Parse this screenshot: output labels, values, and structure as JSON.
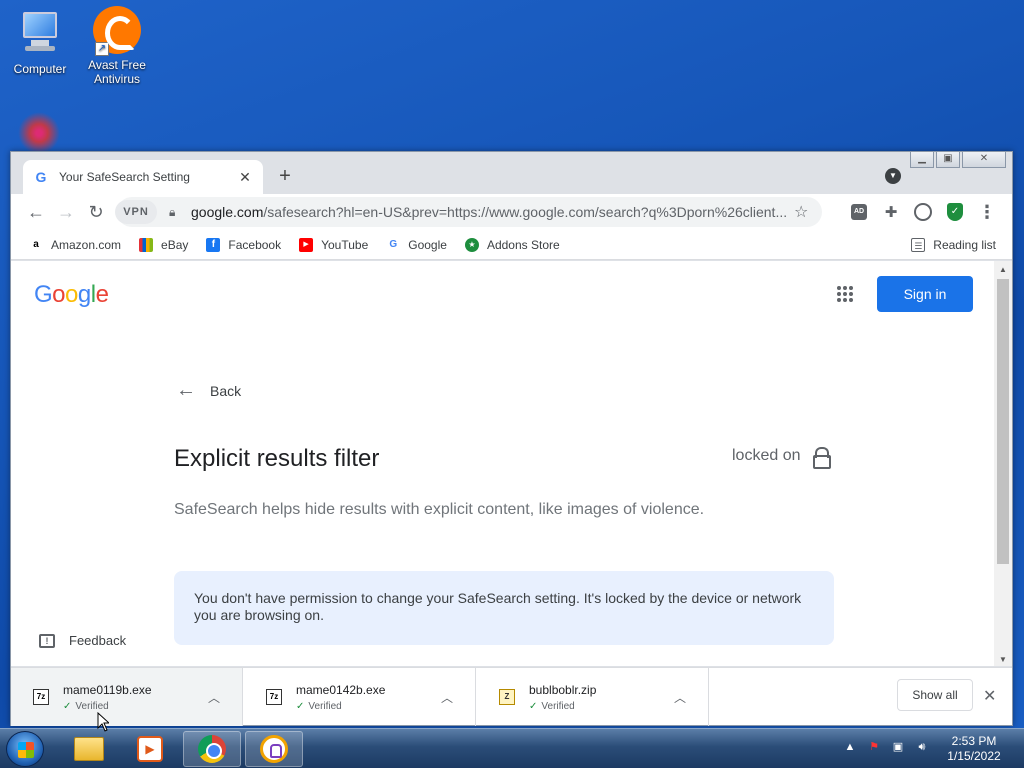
{
  "desktop": {
    "icons": [
      {
        "label": "Computer"
      },
      {
        "label_line1": "Avast Free",
        "label_line2": "Antivirus"
      }
    ]
  },
  "browser": {
    "tab": {
      "title": "Your SafeSearch Setting"
    },
    "toolbar": {
      "vpn_label": "VPN",
      "url_host": "google.com",
      "url_path": "/safesearch?hl=en-US&prev=https://www.google.com/search?q%3Dporn%26client..."
    },
    "bookmarks": [
      {
        "label": "Amazon.com",
        "icon": "a",
        "color": "#000000"
      },
      {
        "label": "eBay",
        "icon": "e",
        "color": "#e53238"
      },
      {
        "label": "Facebook",
        "icon": "f",
        "color": "#1877f2"
      },
      {
        "label": "YouTube",
        "icon": "▶",
        "color": "#ff0000"
      },
      {
        "label": "Google",
        "icon": "G",
        "color": "#4285f4"
      },
      {
        "label": "Addons Store",
        "icon": "★",
        "color": "#1e8e3e"
      }
    ],
    "reading_list": "Reading list"
  },
  "page": {
    "logo": [
      "G",
      "o",
      "o",
      "g",
      "l",
      "e"
    ],
    "sign_in": "Sign in",
    "back": "Back",
    "heading": "Explicit results filter",
    "locked_status": "locked on",
    "description": "SafeSearch helps hide results with explicit content, like images of violence.",
    "notice": "You don't have permission to change your SafeSearch setting. It's locked by the device or network you are browsing on.",
    "feedback": "Feedback"
  },
  "downloads": {
    "items": [
      {
        "name": "mame0119b.exe",
        "status": "Verified",
        "type": "7z"
      },
      {
        "name": "mame0142b.exe",
        "status": "Verified",
        "type": "7z"
      },
      {
        "name": "bublboblr.zip",
        "status": "Verified",
        "type": "zip"
      }
    ],
    "show_all": "Show all"
  },
  "taskbar": {
    "time": "2:53 PM",
    "date": "1/15/2022"
  },
  "colors": {
    "accent": "#1a73e8",
    "notice_bg": "#e8f0fe",
    "verified": "#1e8e3e"
  }
}
